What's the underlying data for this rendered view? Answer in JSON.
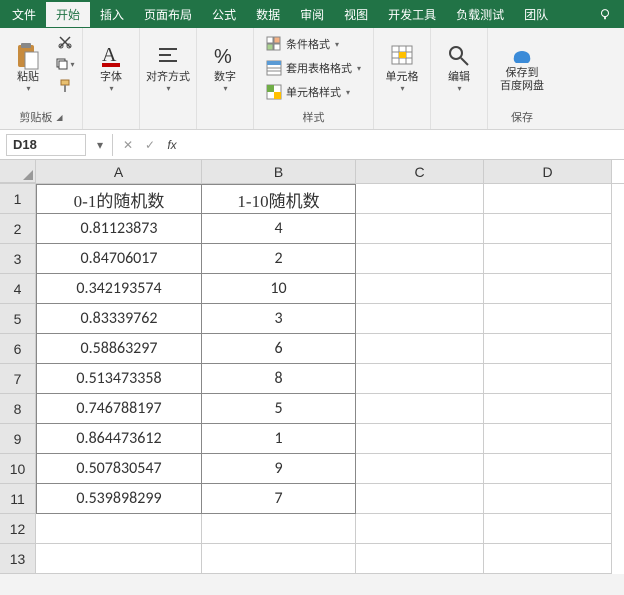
{
  "tabs": {
    "file": "文件",
    "start": "开始",
    "insert": "插入",
    "layout": "页面布局",
    "formula": "公式",
    "data": "数据",
    "review": "审阅",
    "view": "视图",
    "dev": "开发工具",
    "load": "负载测试",
    "team": "团队"
  },
  "ribbon": {
    "clipboard": {
      "paste": "粘贴",
      "label": "剪贴板"
    },
    "font": {
      "label": "字体"
    },
    "align": {
      "label": "对齐方式"
    },
    "number": {
      "label": "数字"
    },
    "styles": {
      "cond": "条件格式",
      "table": "套用表格格式",
      "cell": "单元格样式",
      "label": "样式"
    },
    "cells": {
      "label": "单元格"
    },
    "editing": {
      "label": "编辑"
    },
    "save": {
      "line1": "保存到",
      "line2": "百度网盘",
      "label": "保存"
    }
  },
  "formulabar": {
    "name": "D18",
    "fx": "fx",
    "value": ""
  },
  "columns": [
    "A",
    "B",
    "C",
    "D"
  ],
  "rows": [
    "1",
    "2",
    "3",
    "4",
    "5",
    "6",
    "7",
    "8",
    "9",
    "10",
    "11",
    "12",
    "13"
  ],
  "headers": {
    "A": "0-1的随机数",
    "B": "1-10随机数"
  },
  "dataA": [
    "0.81123873",
    "0.84706017",
    "0.342193574",
    "0.83339762",
    "0.58863297",
    "0.513473358",
    "0.746788197",
    "0.864473612",
    "0.507830547",
    "0.539898299"
  ],
  "dataB": [
    "4",
    "2",
    "10",
    "3",
    "6",
    "8",
    "5",
    "1",
    "9",
    "7"
  ],
  "chart_data": {
    "type": "table",
    "title": "",
    "columns": [
      "0-1的随机数",
      "1-10随机数"
    ],
    "series": [
      {
        "name": "0-1的随机数",
        "values": [
          0.81123873,
          0.84706017,
          0.342193574,
          0.83339762,
          0.58863297,
          0.513473358,
          0.746788197,
          0.864473612,
          0.507830547,
          0.539898299
        ]
      },
      {
        "name": "1-10随机数",
        "values": [
          4,
          2,
          10,
          3,
          6,
          8,
          5,
          1,
          9,
          7
        ]
      }
    ]
  }
}
